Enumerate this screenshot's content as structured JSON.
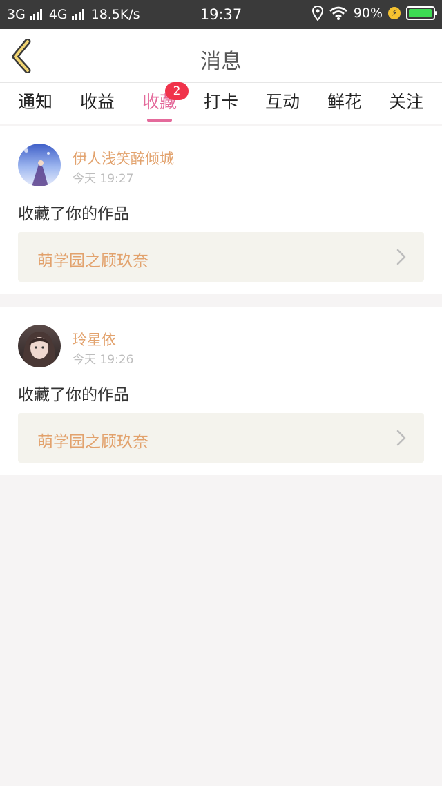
{
  "status_bar": {
    "net1": "3G",
    "net2": "4G",
    "speed": "18.5K/s",
    "time": "19:37",
    "battery": "90%",
    "battery_color": "#3ddc53"
  },
  "header": {
    "title": "消息",
    "back_icon": "chevron-left-icon"
  },
  "tabs": [
    {
      "label": "通知"
    },
    {
      "label": "收益"
    },
    {
      "label": "收藏",
      "badge": "2",
      "active": true
    },
    {
      "label": "打卡"
    },
    {
      "label": "互动"
    },
    {
      "label": "鲜花"
    },
    {
      "label": "关注"
    }
  ],
  "accent_color": "#e46a9b",
  "messages": [
    {
      "username": "伊人浅笑醉倾城",
      "time": "今天 19:27",
      "action": "收藏了你的作品",
      "work_title": "萌学园之顾玖奈"
    },
    {
      "username": "玲星依",
      "time": "今天 19:26",
      "action": "收藏了你的作品",
      "work_title": "萌学园之顾玖奈"
    }
  ]
}
